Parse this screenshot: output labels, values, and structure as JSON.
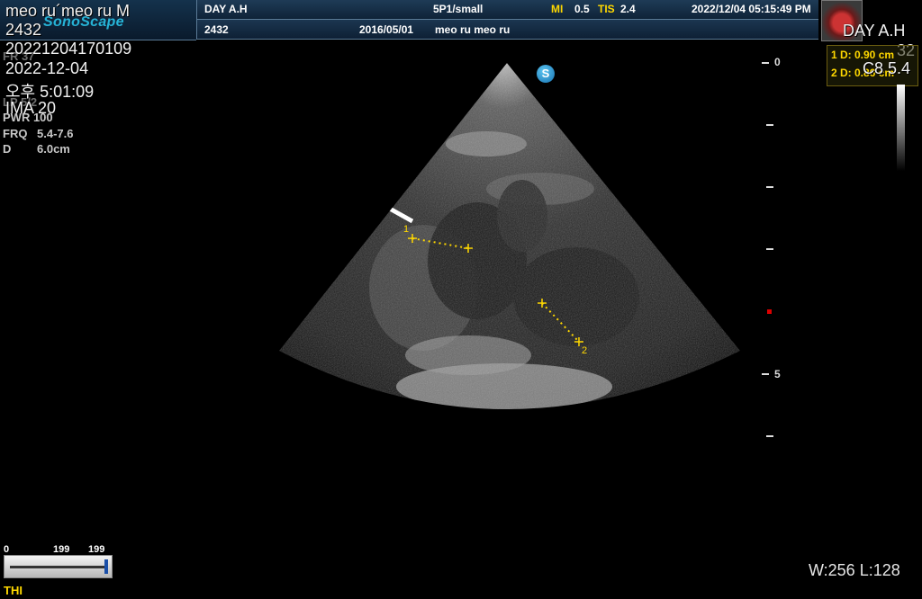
{
  "header": {
    "brand": "SonoScape",
    "hospital": "DAY A.H",
    "probe": "5P1/small",
    "mi_label": "MI",
    "mi_value": "0.5",
    "tis_label": "TIS",
    "tis_value": "2.4",
    "datetime": "2022/12/04 05:15:49 PM",
    "patient_id": "2432",
    "dob": "2016/05/01",
    "patient_name": "meo ru meo ru"
  },
  "overlay": {
    "name_line": "meo ru´meo ru M",
    "id_line": "2432",
    "study_code": "20221204170109",
    "date_line": "2022-12-04",
    "time_line": "오후 5:01:09",
    "ima_line": "IMA 20",
    "hospital_right": "DAY A.H",
    "right_num": "32",
    "right_code": "C8 5.4"
  },
  "params": {
    "pwr": "PWR 100",
    "frq_label": "FRQ",
    "frq_value": "5.4-7.6",
    "d_label": "D",
    "d_value": "6.0cm",
    "faint_fr": "FR 37",
    "faint_lp": "LP 5/2"
  },
  "measurements": [
    {
      "label": "1 D: 0.90 cm"
    },
    {
      "label": "2 D: 0.86 cm"
    }
  ],
  "markers": {
    "m1": "1",
    "m2": "2"
  },
  "depth": {
    "zero": "0",
    "five": "5"
  },
  "slider": {
    "min": "0",
    "mid": "199",
    "max": "199"
  },
  "mode": "THI",
  "window_level": "W:256 L:128",
  "s_icon": "S",
  "colors": {
    "accent": "#ffd800",
    "brand": "#26b3d6",
    "header": "#1e3b56"
  }
}
